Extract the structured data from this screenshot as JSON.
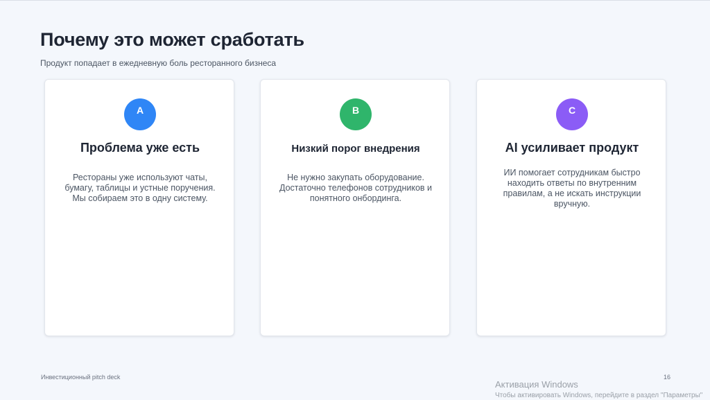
{
  "slide": {
    "title": "Почему это может сработать",
    "subtitle": "Продукт попадает в ежедневную боль ресторанного бизнеса",
    "cards": [
      {
        "badge": "A",
        "badge_color": "#2f86f6",
        "title": "Проблема уже есть",
        "text": "Рестораны уже используют чаты, бумагу, таблицы и устные поручения. Мы собираем это в одну систему."
      },
      {
        "badge": "B",
        "badge_color": "#2fb56b",
        "title": "Низкий порог внедрения",
        "text": "Не нужно закупать оборудование. Достаточно телефонов сотрудников и понятного онбординга."
      },
      {
        "badge": "C",
        "badge_color": "#8b5cf6",
        "title": "AI усиливает продукт",
        "text": "ИИ помогает сотрудникам быстро находить ответы по внутренним правилам, а не искать инструкции вручную."
      }
    ],
    "footer": "Инвестиционный pitch deck",
    "page_number": "16"
  },
  "windows_watermark": {
    "title": "Активация Windows",
    "text": "Чтобы активировать Windows, перейдите в раздел \"Параметры\""
  }
}
